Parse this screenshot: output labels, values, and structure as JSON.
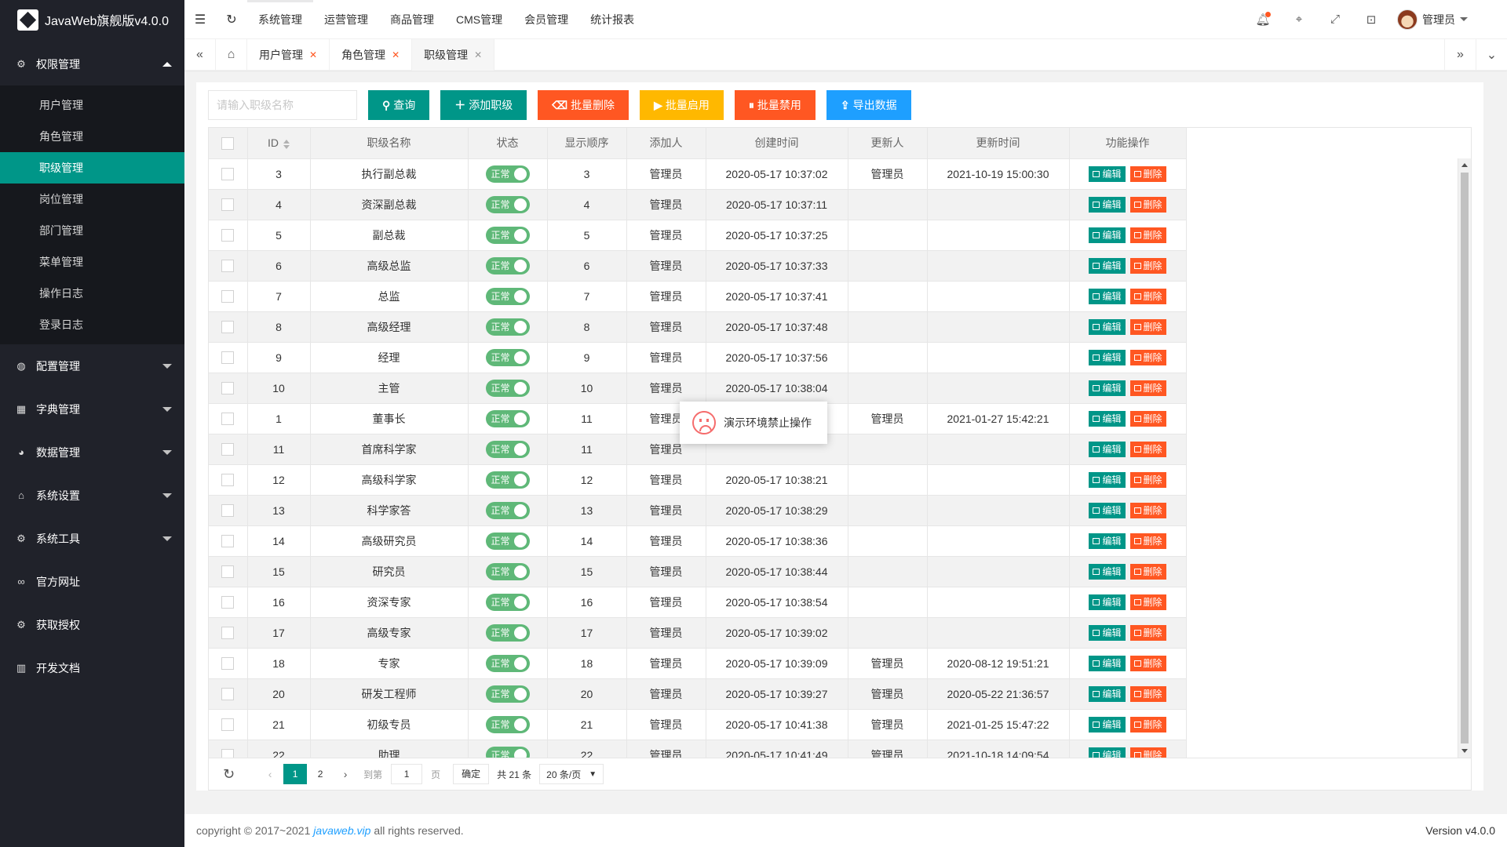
{
  "app": {
    "title": "JavaWeb旗舰版v4.0.0"
  },
  "sidebar": {
    "groups": [
      {
        "label": "权限管理",
        "icon": "gear-icon",
        "open": true
      },
      {
        "label": "配置管理",
        "icon": "globe-icon"
      },
      {
        "label": "字典管理",
        "icon": "grid-icon"
      },
      {
        "label": "数据管理",
        "icon": "palette-icon"
      },
      {
        "label": "系统设置",
        "icon": "home-icon"
      },
      {
        "label": "系统工具",
        "icon": "gear-icon"
      },
      {
        "label": "官方网址",
        "icon": "link-icon"
      },
      {
        "label": "获取授权",
        "icon": "gear-icon"
      },
      {
        "label": "开发文档",
        "icon": "book-icon"
      }
    ],
    "sub_items": [
      "用户管理",
      "角色管理",
      "职级管理",
      "岗位管理",
      "部门管理",
      "菜单管理",
      "操作日志",
      "登录日志"
    ]
  },
  "header": {
    "menus": [
      "系统管理",
      "运营管理",
      "商品管理",
      "CMS管理",
      "会员管理",
      "统计报表"
    ],
    "user": "管理员"
  },
  "tabs": [
    "用户管理",
    "角色管理",
    "职级管理"
  ],
  "toolbar": {
    "search_placeholder": "请输入职级名称",
    "query": "查询",
    "add": "添加职级",
    "batch_delete": "批量删除",
    "batch_enable": "批量启用",
    "batch_disable": "批量禁用",
    "export": "导出数据"
  },
  "table": {
    "headers": [
      "ID",
      "职级名称",
      "状态",
      "显示顺序",
      "添加人",
      "创建时间",
      "更新人",
      "更新时间",
      "功能操作"
    ],
    "status_label": "正常",
    "edit_label": "编辑",
    "delete_label": "删除",
    "rows": [
      [
        "3",
        "执行副总裁",
        "3",
        "管理员",
        "2020-05-17 10:37:02",
        "管理员",
        "2021-10-19 15:00:30"
      ],
      [
        "4",
        "资深副总裁",
        "4",
        "管理员",
        "2020-05-17 10:37:11",
        "",
        ""
      ],
      [
        "5",
        "副总裁",
        "5",
        "管理员",
        "2020-05-17 10:37:25",
        "",
        ""
      ],
      [
        "6",
        "高级总监",
        "6",
        "管理员",
        "2020-05-17 10:37:33",
        "",
        ""
      ],
      [
        "7",
        "总监",
        "7",
        "管理员",
        "2020-05-17 10:37:41",
        "",
        ""
      ],
      [
        "8",
        "高级经理",
        "8",
        "管理员",
        "2020-05-17 10:37:48",
        "",
        ""
      ],
      [
        "9",
        "经理",
        "9",
        "管理员",
        "2020-05-17 10:37:56",
        "",
        ""
      ],
      [
        "10",
        "主管",
        "10",
        "管理员",
        "2020-05-17 10:38:04",
        "",
        ""
      ],
      [
        "1",
        "董事长",
        "11",
        "管理员",
        "",
        "管理员",
        "2021-01-27 15:42:21"
      ],
      [
        "11",
        "首席科学家",
        "11",
        "管理员",
        "",
        "",
        ""
      ],
      [
        "12",
        "高级科学家",
        "12",
        "管理员",
        "2020-05-17 10:38:21",
        "",
        ""
      ],
      [
        "13",
        "科学家答",
        "13",
        "管理员",
        "2020-05-17 10:38:29",
        "",
        ""
      ],
      [
        "14",
        "高级研究员",
        "14",
        "管理员",
        "2020-05-17 10:38:36",
        "",
        ""
      ],
      [
        "15",
        "研究员",
        "15",
        "管理员",
        "2020-05-17 10:38:44",
        "",
        ""
      ],
      [
        "16",
        "资深专家",
        "16",
        "管理员",
        "2020-05-17 10:38:54",
        "",
        ""
      ],
      [
        "17",
        "高级专家",
        "17",
        "管理员",
        "2020-05-17 10:39:02",
        "",
        ""
      ],
      [
        "18",
        "专家",
        "18",
        "管理员",
        "2020-05-17 10:39:09",
        "管理员",
        "2020-08-12 19:51:21"
      ],
      [
        "20",
        "研发工程师",
        "20",
        "管理员",
        "2020-05-17 10:39:27",
        "管理员",
        "2020-05-22 21:36:57"
      ],
      [
        "21",
        "初级专员",
        "21",
        "管理员",
        "2020-05-17 10:41:38",
        "管理员",
        "2021-01-25 15:47:22"
      ],
      [
        "22",
        "助理",
        "22",
        "管理员",
        "2020-05-17 10:41:49",
        "管理员",
        "2021-10-18 14:09:54"
      ]
    ]
  },
  "pager": {
    "pages": [
      "1",
      "2"
    ],
    "goto_label": "到第",
    "goto_value": "1",
    "page_unit": "页",
    "confirm": "确定",
    "total": "共 21 条",
    "size": "20 条/页"
  },
  "toast": "演示环境禁止操作",
  "footer": {
    "copyright_prefix": "copyright © 2017~2021",
    "link": "javaweb.vip",
    "copyright_suffix": "all rights reserved.",
    "version": "Version v4.0.0"
  },
  "colors": {
    "accent": "#009688",
    "danger": "#ff5722",
    "warn": "#ffb800",
    "info": "#1e9fff",
    "switch_on": "#5fb878",
    "sidebar": "#20222a"
  }
}
